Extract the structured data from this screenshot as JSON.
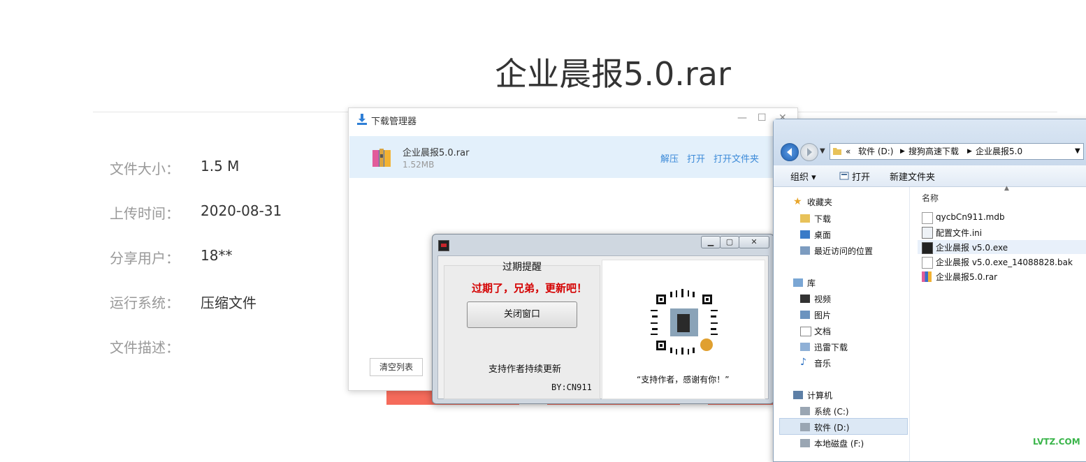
{
  "page": {
    "title": "企业晨报5.0.rar",
    "info": [
      {
        "label": "文件大小：",
        "value": "1.5 M"
      },
      {
        "label": "上传时间：",
        "value": "2020-08-31"
      },
      {
        "label": "分享用户：",
        "value": "18**"
      },
      {
        "label": "运行系统：",
        "value": "压缩文件"
      },
      {
        "label": "文件描述：",
        "value": ""
      }
    ],
    "watermark": "LVTZ.COM"
  },
  "download_manager": {
    "title": "下载管理器",
    "file_name": "企业晨报5.0.rar",
    "file_size": "1.52MB",
    "actions": [
      "解压",
      "打开",
      "打开文件夹"
    ],
    "clear_button": "清空列表",
    "controls": {
      "minimize": "—",
      "maximize": "☐",
      "close": "✕"
    }
  },
  "expiry_dialog": {
    "group_title": "过期提醒",
    "expired_message": "过期了，兄弟，更新吧！",
    "close_button": "关闭窗口",
    "support_text": "支持作者持续更新",
    "author": "BY:CN911",
    "thanks": "“支持作者，感谢有你！”",
    "controls": {
      "minimize": "▁",
      "maximize": "▢",
      "close": "✕"
    }
  },
  "explorer": {
    "address": [
      "«",
      "软件 (D:)",
      "搜狗高速下载",
      "企业晨报5.0"
    ],
    "toolbar": [
      "组织 ▾",
      "打开",
      "新建文件夹"
    ],
    "column_header": "名称",
    "favorites": {
      "header": "收藏夹",
      "items": [
        "下载",
        "桌面",
        "最近访问的位置"
      ]
    },
    "libraries": {
      "header": "库",
      "items": [
        "视频",
        "图片",
        "文档",
        "迅雷下载",
        "音乐"
      ]
    },
    "computer": {
      "header": "计算机",
      "items": [
        "系统 (C:)",
        "软件 (D:)",
        "本地磁盘 (F:)"
      ]
    },
    "files": [
      "qycbCn911.mdb",
      "配置文件.ini",
      "企业晨报 v5.0.exe",
      "企业晨报 v5.0.exe_14088828.bak",
      "企业晨报5.0.rar"
    ],
    "colors": {
      "selection": "#dce8f5",
      "chrome": "#c9d9ec"
    }
  }
}
